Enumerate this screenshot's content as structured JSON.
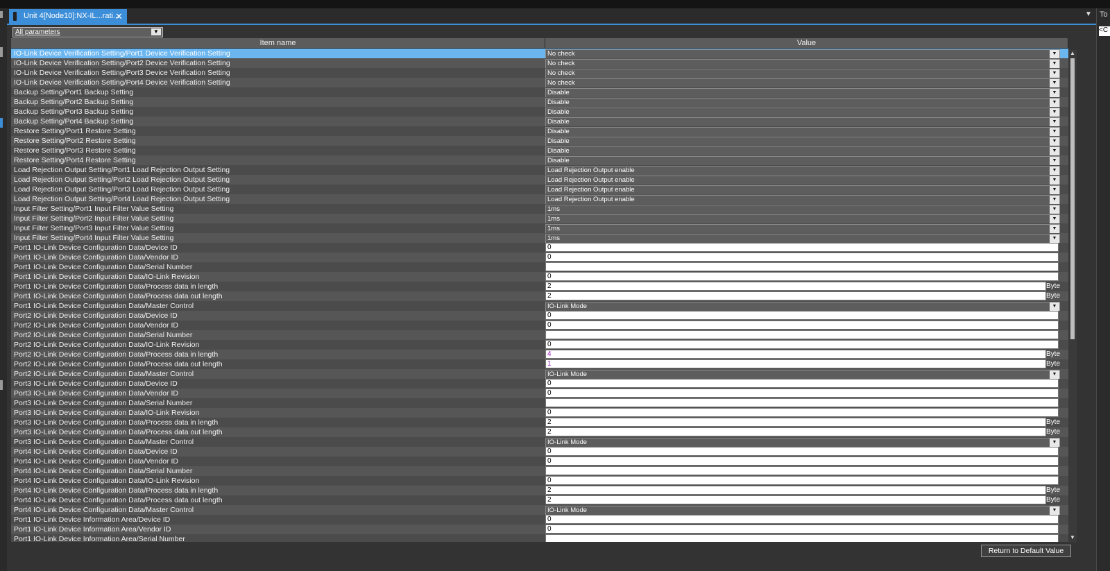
{
  "tab": {
    "title": "Unit 4[Node10]:NX-IL...rati..."
  },
  "filter": {
    "selected": "All parameters"
  },
  "table": {
    "headers": {
      "item_name": "Item name",
      "value": "Value"
    },
    "rows": [
      {
        "name": "IO-Link Device Verification Setting/Port1 Device Verification Setting",
        "value": "No check",
        "kind": "select",
        "selected": true
      },
      {
        "name": "IO-Link Device Verification Setting/Port2 Device Verification Setting",
        "value": "No check",
        "kind": "select"
      },
      {
        "name": "IO-Link Device Verification Setting/Port3 Device Verification Setting",
        "value": "No check",
        "kind": "select"
      },
      {
        "name": "IO-Link Device Verification Setting/Port4 Device Verification Setting",
        "value": "No check",
        "kind": "select"
      },
      {
        "name": "Backup Setting/Port1 Backup Setting",
        "value": "Disable",
        "kind": "select"
      },
      {
        "name": "Backup Setting/Port2 Backup Setting",
        "value": "Disable",
        "kind": "select"
      },
      {
        "name": "Backup Setting/Port3 Backup Setting",
        "value": "Disable",
        "kind": "select"
      },
      {
        "name": "Backup Setting/Port4 Backup Setting",
        "value": "Disable",
        "kind": "select"
      },
      {
        "name": "Restore Setting/Port1 Restore Setting",
        "value": "Disable",
        "kind": "select"
      },
      {
        "name": "Restore Setting/Port2 Restore Setting",
        "value": "Disable",
        "kind": "select"
      },
      {
        "name": "Restore Setting/Port3 Restore Setting",
        "value": "Disable",
        "kind": "select"
      },
      {
        "name": "Restore Setting/Port4 Restore Setting",
        "value": "Disable",
        "kind": "select"
      },
      {
        "name": "Load Rejection Output Setting/Port1 Load Rejection Output Setting",
        "value": "Load Rejection Output enable",
        "kind": "select"
      },
      {
        "name": "Load Rejection Output Setting/Port2 Load Rejection Output Setting",
        "value": "Load Rejection Output enable",
        "kind": "select"
      },
      {
        "name": "Load Rejection Output Setting/Port3 Load Rejection Output Setting",
        "value": "Load Rejection Output enable",
        "kind": "select"
      },
      {
        "name": "Load Rejection Output Setting/Port4 Load Rejection Output Setting",
        "value": "Load Rejection Output enable",
        "kind": "select"
      },
      {
        "name": "Input Filter Setting/Port1 Input Filter Value Setting",
        "value": "1ms",
        "kind": "select"
      },
      {
        "name": "Input Filter Setting/Port2 Input Filter Value Setting",
        "value": "1ms",
        "kind": "select"
      },
      {
        "name": "Input Filter Setting/Port3 Input Filter Value Setting",
        "value": "1ms",
        "kind": "select"
      },
      {
        "name": "Input Filter Setting/Port4 Input Filter Value Setting",
        "value": "1ms",
        "kind": "select"
      },
      {
        "name": "Port1 IO-Link Device Configuration Data/Device ID",
        "value": "0",
        "kind": "input"
      },
      {
        "name": "Port1 IO-Link Device Configuration Data/Vendor ID",
        "value": "0",
        "kind": "input"
      },
      {
        "name": "Port1 IO-Link Device Configuration Data/Serial Number",
        "value": "",
        "kind": "input"
      },
      {
        "name": "Port1 IO-Link Device Configuration Data/IO-Link Revision",
        "value": "0",
        "kind": "input"
      },
      {
        "name": "Port1 IO-Link Device Configuration Data/Process data in length",
        "value": "2",
        "kind": "input",
        "unit": "Byte"
      },
      {
        "name": "Port1 IO-Link Device Configuration Data/Process data out length",
        "value": "2",
        "kind": "input",
        "unit": "Byte"
      },
      {
        "name": "Port1 IO-Link Device Configuration Data/Master Control",
        "value": "IO-Link Mode",
        "kind": "select"
      },
      {
        "name": "Port2 IO-Link Device Configuration Data/Device ID",
        "value": "0",
        "kind": "input"
      },
      {
        "name": "Port2 IO-Link Device Configuration Data/Vendor ID",
        "value": "0",
        "kind": "input"
      },
      {
        "name": "Port2 IO-Link Device Configuration Data/Serial Number",
        "value": "",
        "kind": "input"
      },
      {
        "name": "Port2 IO-Link Device Configuration Data/IO-Link Revision",
        "value": "0",
        "kind": "input"
      },
      {
        "name": "Port2 IO-Link Device Configuration Data/Process data in length",
        "value": "4",
        "kind": "input",
        "unit": "Byte",
        "changed": true
      },
      {
        "name": "Port2 IO-Link Device Configuration Data/Process data out length",
        "value": "1",
        "kind": "input",
        "unit": "Byte",
        "changed": true
      },
      {
        "name": "Port2 IO-Link Device Configuration Data/Master Control",
        "value": "IO-Link Mode",
        "kind": "select"
      },
      {
        "name": "Port3 IO-Link Device Configuration Data/Device ID",
        "value": "0",
        "kind": "input"
      },
      {
        "name": "Port3 IO-Link Device Configuration Data/Vendor ID",
        "value": "0",
        "kind": "input"
      },
      {
        "name": "Port3 IO-Link Device Configuration Data/Serial Number",
        "value": "",
        "kind": "input"
      },
      {
        "name": "Port3 IO-Link Device Configuration Data/IO-Link Revision",
        "value": "0",
        "kind": "input"
      },
      {
        "name": "Port3 IO-Link Device Configuration Data/Process data in length",
        "value": "2",
        "kind": "input",
        "unit": "Byte"
      },
      {
        "name": "Port3 IO-Link Device Configuration Data/Process data out length",
        "value": "2",
        "kind": "input",
        "unit": "Byte"
      },
      {
        "name": "Port3 IO-Link Device Configuration Data/Master Control",
        "value": "IO-Link Mode",
        "kind": "select"
      },
      {
        "name": "Port4 IO-Link Device Configuration Data/Device ID",
        "value": "0",
        "kind": "input"
      },
      {
        "name": "Port4 IO-Link Device Configuration Data/Vendor ID",
        "value": "0",
        "kind": "input"
      },
      {
        "name": "Port4 IO-Link Device Configuration Data/Serial Number",
        "value": "",
        "kind": "input"
      },
      {
        "name": "Port4 IO-Link Device Configuration Data/IO-Link Revision",
        "value": "0",
        "kind": "input"
      },
      {
        "name": "Port4 IO-Link Device Configuration Data/Process data in length",
        "value": "2",
        "kind": "input",
        "unit": "Byte"
      },
      {
        "name": "Port4 IO-Link Device Configuration Data/Process data out length",
        "value": "2",
        "kind": "input",
        "unit": "Byte"
      },
      {
        "name": "Port4 IO-Link Device Configuration Data/Master Control",
        "value": "IO-Link Mode",
        "kind": "select"
      },
      {
        "name": "Port1 IO-Link Device Information Area/Device ID",
        "value": "0",
        "kind": "input"
      },
      {
        "name": "Port1 IO-Link Device Information Area/Vendor ID",
        "value": "0",
        "kind": "input"
      },
      {
        "name": "Port1 IO-Link Device Information Area/Serial Number",
        "value": "",
        "kind": "input"
      }
    ]
  },
  "footer": {
    "default_button": "Return to Default Value"
  },
  "right_panel": {
    "title": "To",
    "input_value": "<C"
  },
  "colors": {
    "accent": "#3d8ed8",
    "selected_row": "#6cb6f0",
    "changed_value": "#a020d0"
  }
}
